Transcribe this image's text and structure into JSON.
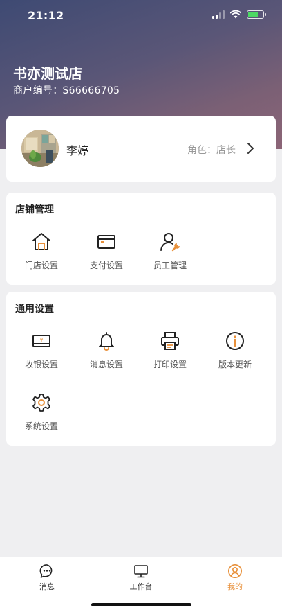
{
  "status_bar": {
    "time": "21:12"
  },
  "header": {
    "store_name": "书亦测试店",
    "merchant_label": "商户编号：",
    "merchant_id": "S66666705"
  },
  "profile": {
    "name": "李婷",
    "role_label": "角色：",
    "role": "店长"
  },
  "store_management": {
    "title": "店铺管理",
    "items": [
      {
        "label": "门店设置",
        "icon": "store-icon"
      },
      {
        "label": "支付设置",
        "icon": "card-icon"
      },
      {
        "label": "员工管理",
        "icon": "staff-icon"
      }
    ]
  },
  "general_settings": {
    "title": "通用设置",
    "items": [
      {
        "label": "收银设置",
        "icon": "cashier-icon"
      },
      {
        "label": "消息设置",
        "icon": "bell-icon"
      },
      {
        "label": "打印设置",
        "icon": "printer-icon"
      },
      {
        "label": "版本更新",
        "icon": "info-icon"
      },
      {
        "label": "系统设置",
        "icon": "gear-icon"
      }
    ]
  },
  "tab_bar": {
    "tabs": [
      {
        "label": "消息",
        "icon": "chat-icon",
        "active": false
      },
      {
        "label": "工作台",
        "icon": "monitor-icon",
        "active": false
      },
      {
        "label": "我的",
        "icon": "user-icon",
        "active": true
      }
    ]
  },
  "colors": {
    "accent": "#e8903a",
    "text_dark": "#222222",
    "text_muted": "#999999"
  }
}
